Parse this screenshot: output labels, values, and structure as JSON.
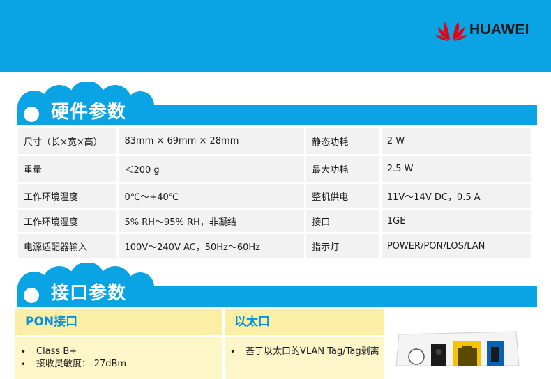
{
  "brand": {
    "name": "HUAWEI"
  },
  "hardware": {
    "title": "硬件参数",
    "rows": [
      {
        "k1": "尺寸（长×宽×高）",
        "v1": "83mm × 69mm × 28mm",
        "k2": "静态功耗",
        "v2": "2 W"
      },
      {
        "k1": "重量",
        "v1": "＜200 g",
        "k2": "最大功耗",
        "v2": "2.5 W"
      },
      {
        "k1": "工作环境温度",
        "v1": "0℃～+40℃",
        "k2": "整机供电",
        "v2": "11V～14V DC，0.5 A"
      },
      {
        "k1": "工作环境湿度",
        "v1": "5% RH～95% RH，非凝结",
        "k2": "接口",
        "v2": "1GE"
      },
      {
        "k1": "电源适配器输入",
        "v1": "100V～240V AC，50Hz～60Hz",
        "k2": "指示灯",
        "v2": "POWER/PON/LOS/LAN"
      }
    ]
  },
  "interfaces": {
    "title": "接口参数",
    "pon": {
      "heading": "PON接口",
      "items": [
        "Class B+",
        "接收灵敏度：-27dBm"
      ]
    },
    "ethernet": {
      "heading": "以太口",
      "items": [
        "基于以太口的VLAN Tag/Tag剥离"
      ]
    }
  },
  "colors": {
    "accent": "#0aa3e4",
    "header_cell": "#fbeea5",
    "body_cell": "#fdf6c8",
    "table_cell": "#f2f2f2"
  }
}
